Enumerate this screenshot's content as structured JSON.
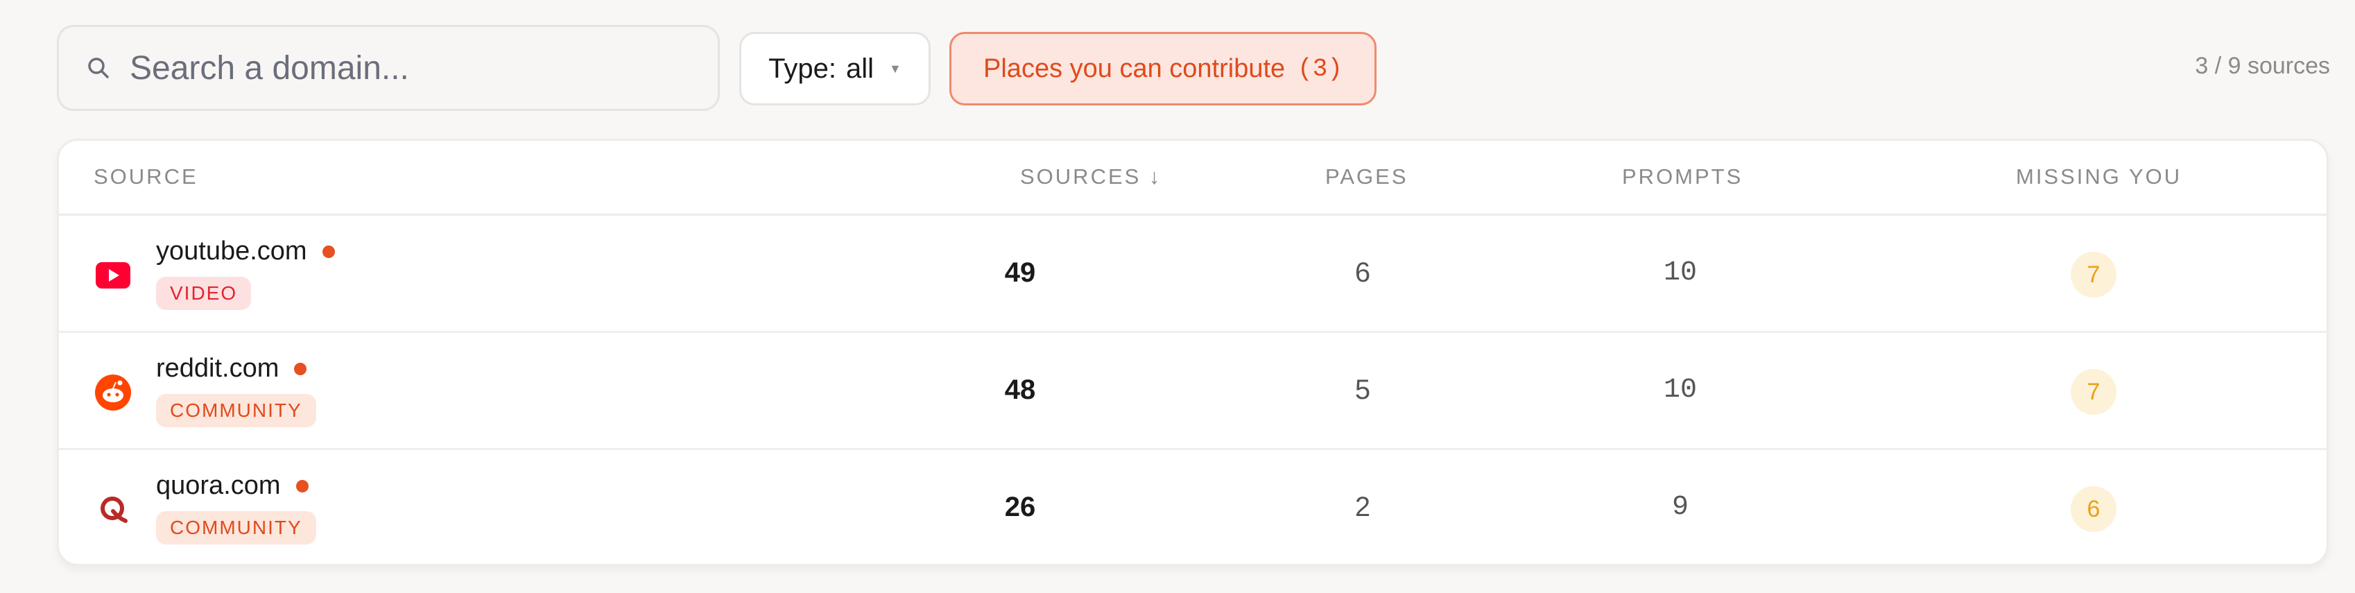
{
  "search": {
    "placeholder": "Search a domain..."
  },
  "type_filter": {
    "label": "Type:",
    "value": "all"
  },
  "contribute_filter": {
    "label": "Places you can contribute",
    "count": "(3)"
  },
  "sources_count": "3 / 9 sources",
  "columns": {
    "source": "SOURCE",
    "sources": "SOURCES ↓",
    "pages": "PAGES",
    "prompts": "PROMPTS",
    "missing": "MISSING YOU"
  },
  "rows": [
    {
      "domain": "youtube.com",
      "tag": "VIDEO",
      "sources": "49",
      "pages": "6",
      "prompts": "10",
      "missing": "7",
      "icon": "youtube-icon"
    },
    {
      "domain": "reddit.com",
      "tag": "COMMUNITY",
      "sources": "48",
      "pages": "5",
      "prompts": "10",
      "missing": "7",
      "icon": "reddit-icon"
    },
    {
      "domain": "quora.com",
      "tag": "COMMUNITY",
      "sources": "26",
      "pages": "2",
      "prompts": "9",
      "missing": "6",
      "icon": "quora-icon"
    }
  ],
  "colors": {
    "accent": "#e8501f",
    "youtube": "#ff0033",
    "reddit": "#ff4500",
    "quora": "#b92b27",
    "missing_badge_bg": "#fdf1d8",
    "missing_badge_text": "#e8a21a"
  }
}
